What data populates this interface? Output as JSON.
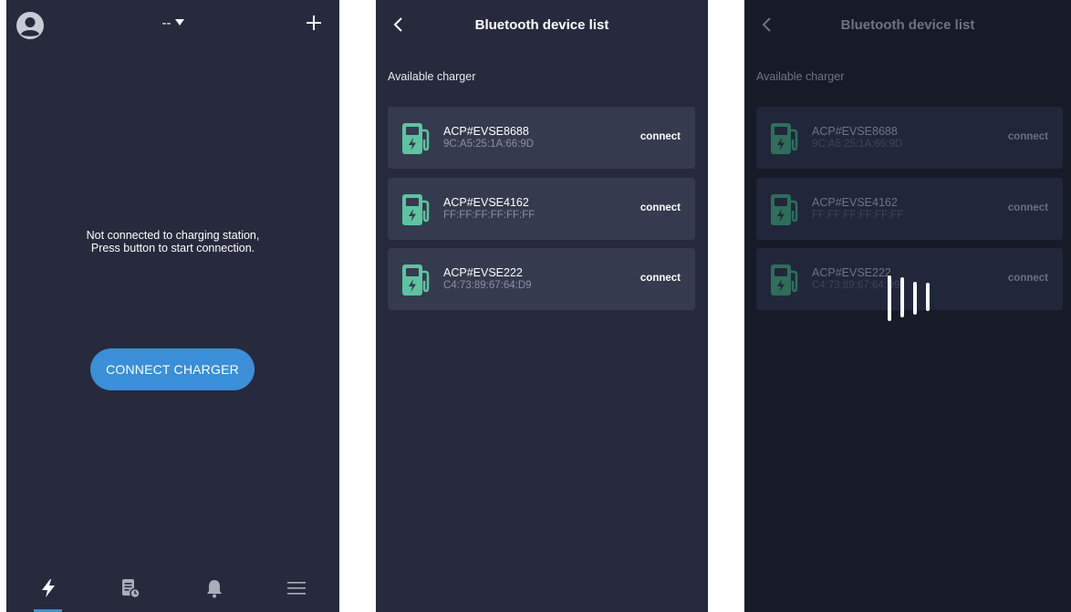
{
  "screen1": {
    "station_selector": "--",
    "status_line1": "Not connected to charging station,",
    "status_line2": "Press button to start connection.",
    "connect_button": "CONNECT CHARGER",
    "nav": [
      "bolt-icon",
      "report-icon",
      "bell-icon",
      "menu-icon"
    ],
    "accent": "#3a8fd8"
  },
  "screen2": {
    "title": "Bluetooth device list",
    "section": "Available charger",
    "devices": [
      {
        "name": "ACP#EVSE8688",
        "mac": "9C:A5:25:1A:66:9D",
        "action": "connect"
      },
      {
        "name": "ACP#EVSE4162",
        "mac": "FF:FF:FF:FF:FF:FF",
        "action": "connect"
      },
      {
        "name": "ACP#EVSE222",
        "mac": "C4:73:89:67:64:D9",
        "action": "connect"
      }
    ],
    "icon_color": "#5cc4a0"
  },
  "screen3": {
    "title": "Bluetooth device list",
    "section": "Available charger",
    "devices": [
      {
        "name": "ACP#EVSE8688",
        "mac": "9C:A5:25:1A:66:9D",
        "action": "connect"
      },
      {
        "name": "ACP#EVSE4162",
        "mac": "FF:FF:FF:FF:FF:FF",
        "action": "connect"
      },
      {
        "name": "ACP#EVSE222",
        "mac": "C4:73:89:67:64:D9",
        "action": "connect"
      }
    ],
    "icon_color": "#2e6e5b"
  }
}
